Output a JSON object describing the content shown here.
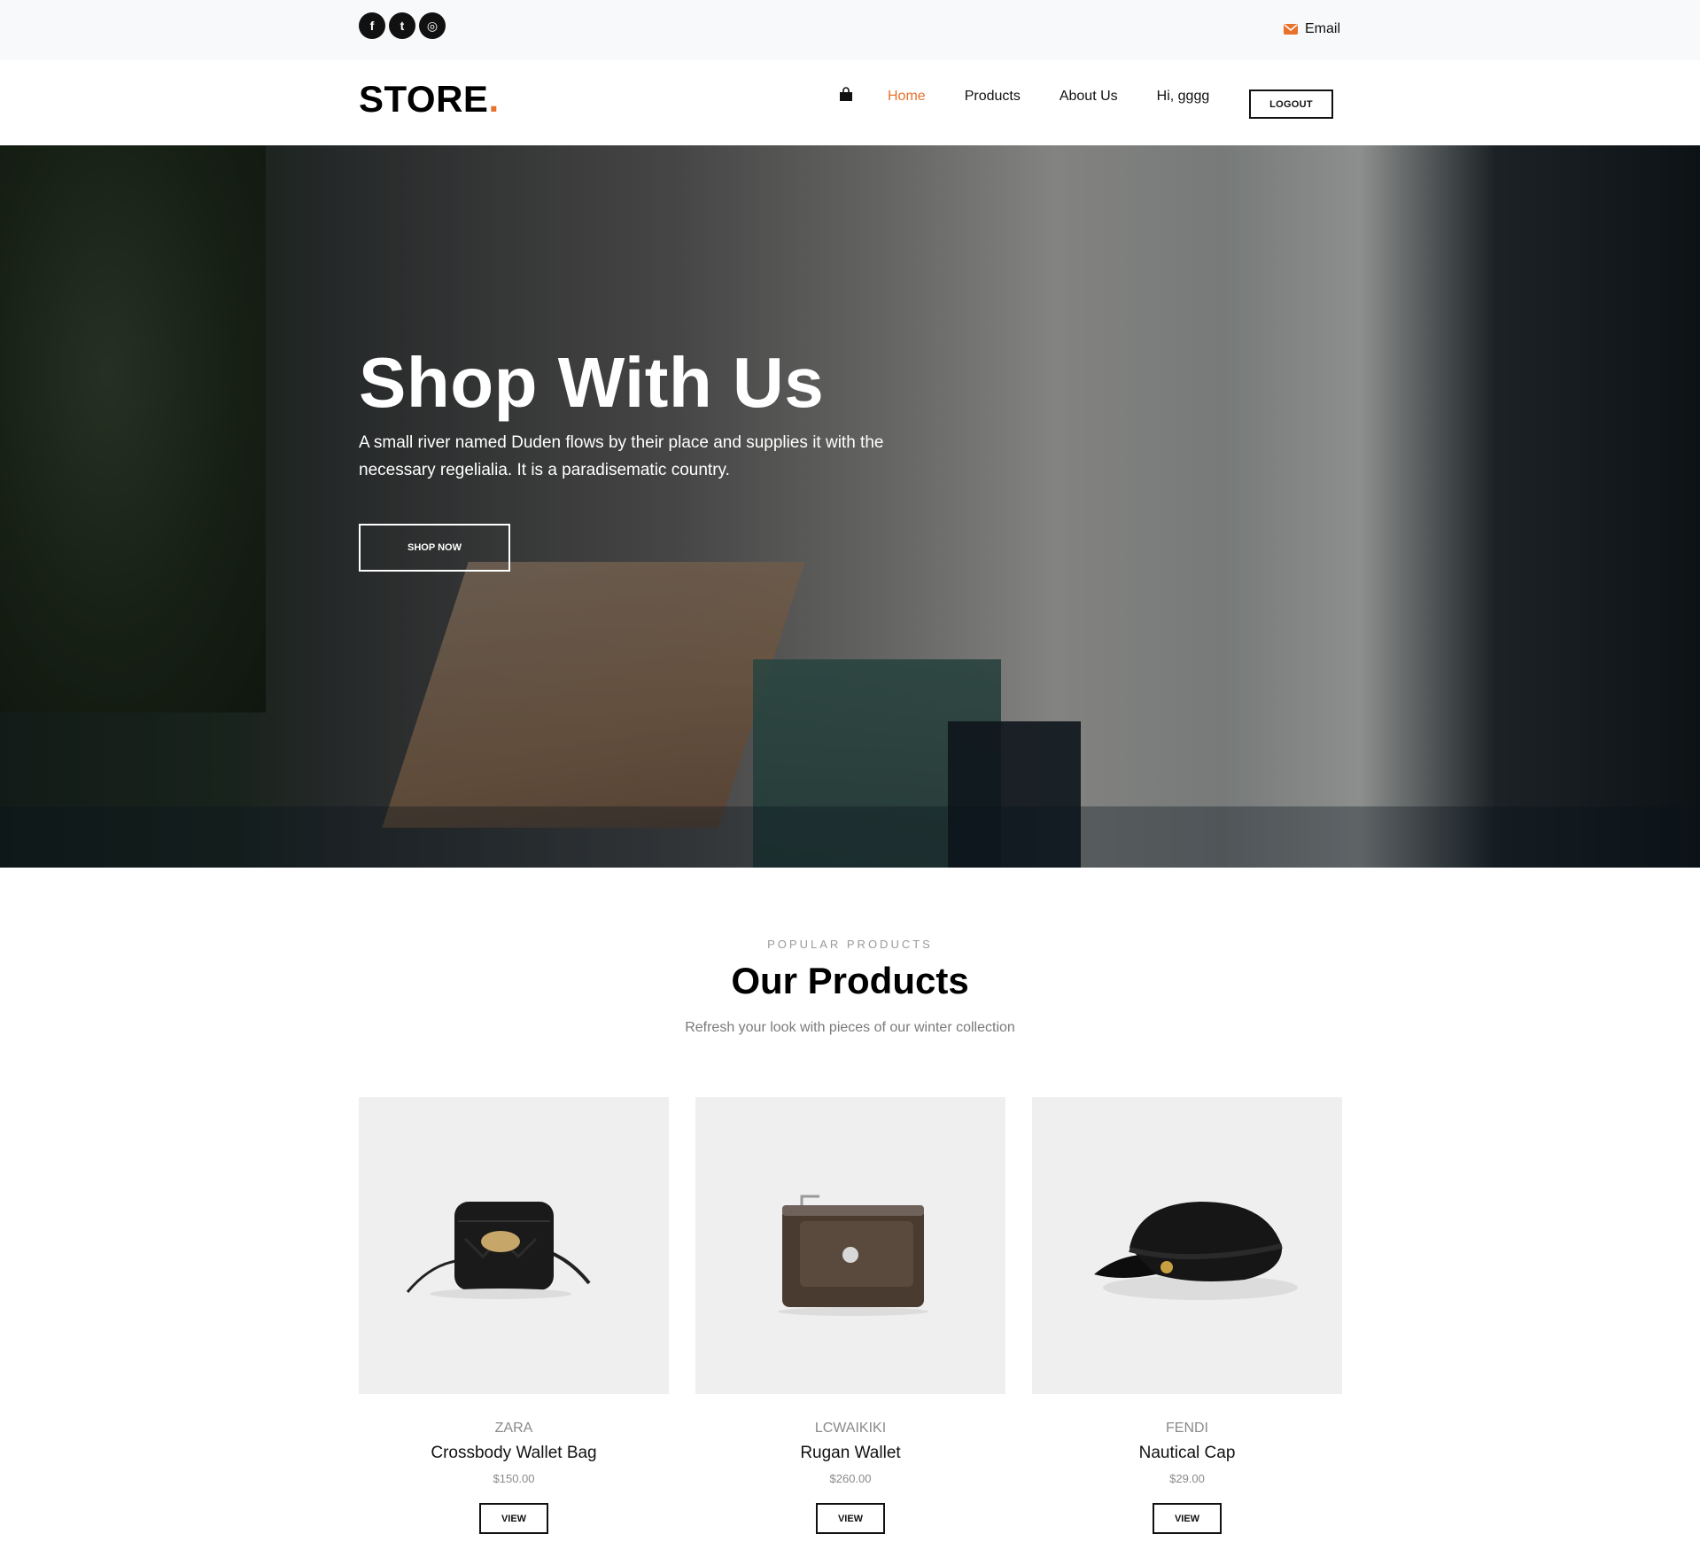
{
  "topbar": {
    "social": [
      {
        "icon": "facebook-icon",
        "glyph": "f"
      },
      {
        "icon": "twitter-icon",
        "glyph": "t"
      },
      {
        "icon": "instagram-icon",
        "glyph": "◎"
      }
    ],
    "email_label": "Email",
    "accent": "#e8722c"
  },
  "nav": {
    "logo_text": "STORE",
    "logo_dot": ".",
    "cart_icon": "shopping-bag-icon",
    "links": [
      "Home",
      "Products",
      "About Us",
      "Hi, gggg"
    ],
    "active": "Home",
    "logout_label": "LOGOUT"
  },
  "hero": {
    "title": "Shop With Us",
    "text": "A small river named Duden flows by their place and supplies it with the necessary regelialia. It is a paradisematic country.",
    "button_label": "SHOP NOW"
  },
  "products_section": {
    "eyebrow": "POPULAR PRODUCTS",
    "title": "Our Products",
    "subtitle": "Refresh your look with pieces of our winter collection"
  },
  "products": [
    {
      "brand": "ZARA",
      "name": "Crossbody Wallet Bag",
      "price": "$150.00",
      "view_label": "VIEW",
      "image_icon": "crossbody-bag-image"
    },
    {
      "brand": "LCWAIKIKI",
      "name": "Rugan Wallet",
      "price": "$260.00",
      "view_label": "VIEW",
      "image_icon": "wallet-image"
    },
    {
      "brand": "FENDI",
      "name": "Nautical Cap",
      "price": "$29.00",
      "view_label": "VIEW",
      "image_icon": "cap-image"
    }
  ]
}
